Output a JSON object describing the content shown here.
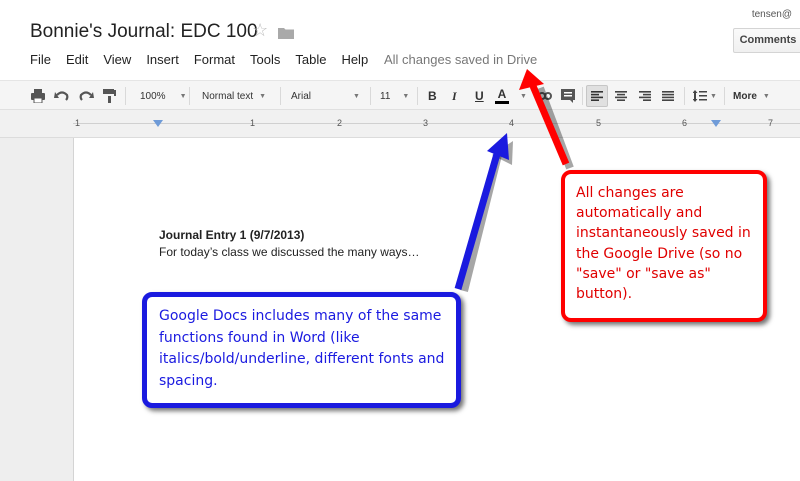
{
  "doc": {
    "title": "Bonnie's Journal: EDC 100",
    "user_email": "tensen@",
    "comments_label": "Comments"
  },
  "menu": [
    "File",
    "Edit",
    "View",
    "Insert",
    "Format",
    "Tools",
    "Table",
    "Help"
  ],
  "save_status": "All changes saved in Drive",
  "toolbar": {
    "zoom": "100%",
    "style": "Normal text",
    "font": "Arial",
    "size": "11",
    "bold": "B",
    "italic": "I",
    "underline": "U",
    "text_color": "A",
    "more": "More",
    "text_color_value": "#000000"
  },
  "ruler": {
    "numbers": [
      "1",
      "1",
      "2",
      "3",
      "4",
      "5",
      "6",
      "7"
    ]
  },
  "content": {
    "entry_title": "Journal Entry 1 (9/7/2013)",
    "entry_body": "For today’s class we discussed the many ways…"
  },
  "callouts": {
    "red_text": "All changes are automatically and instantaneously saved in the Google Drive (so no \"save\" or \"save as\" button).",
    "blue_text": "Google Docs includes many of the same functions found in Word (like italics/bold/underline, different fonts and spacing.",
    "red_color": "#ff0000",
    "blue_color": "#1a1adf"
  }
}
